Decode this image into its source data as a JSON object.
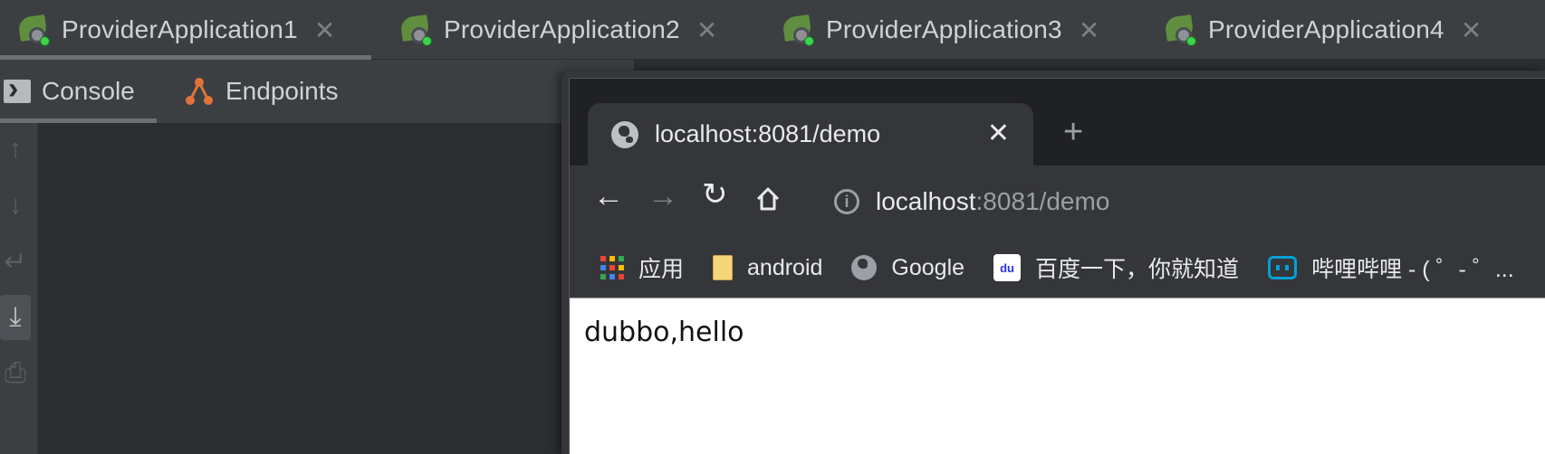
{
  "run_tabs": [
    {
      "label": "ProviderApplication1",
      "active": true
    },
    {
      "label": "ProviderApplication2",
      "active": false
    },
    {
      "label": "ProviderApplication3",
      "active": false
    },
    {
      "label": "ProviderApplication4",
      "active": false
    }
  ],
  "sub_tabs": {
    "console": "Console",
    "endpoints": "Endpoints"
  },
  "browser": {
    "tab_title": "localhost:8081/demo",
    "close_glyph": "✕",
    "new_tab_glyph": "+",
    "url_host": "localhost",
    "url_rest": ":8081/demo",
    "bookmarks": [
      {
        "label": "应用",
        "icon": "apps-grid-icon"
      },
      {
        "label": "android",
        "icon": "folder-icon"
      },
      {
        "label": "Google",
        "icon": "globe-icon"
      },
      {
        "label": "百度一下，你就知道",
        "icon": "baidu-icon"
      },
      {
        "label": "哔哩哔哩 - ( ゜- ゜...",
        "icon": "bilibili-icon"
      }
    ],
    "page_text": "dubbo,hello"
  },
  "colors": {
    "ide_bg": "#2b2d30",
    "ide_panel": "#3c3f41",
    "browser_frame": "#35363a",
    "page_bg": "#ffffff"
  }
}
